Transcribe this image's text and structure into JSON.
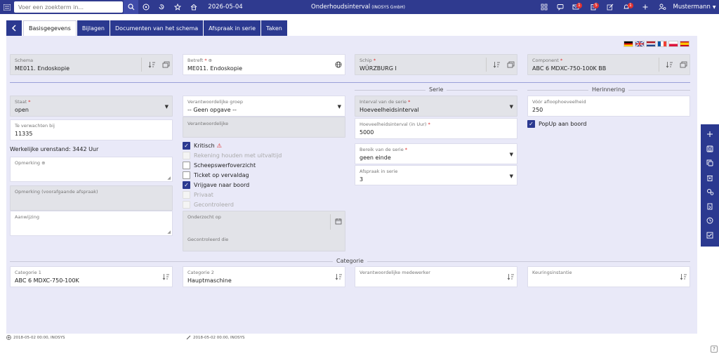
{
  "topbar": {
    "search_placeholder": "Voer een zoekterm in...",
    "date": "2026-05-04",
    "title": "Onderhoudsinterval",
    "company": "(INOSYS GmbH)",
    "mail_count": "1",
    "tasks_count": "5",
    "alerts_count": "1",
    "user": "Mustermann"
  },
  "tabs": [
    {
      "label": "Basisgegevens"
    },
    {
      "label": "Bijlagen"
    },
    {
      "label": "Documenten van het schema"
    },
    {
      "label": "Afspraak in serie"
    },
    {
      "label": "Taken"
    }
  ],
  "top_fields": {
    "schema": {
      "label": "Schema",
      "value": "ME011. Endoskopie"
    },
    "betreft": {
      "label": "Betreft",
      "value": "ME011. Endoskopie"
    },
    "schip": {
      "label": "Schip",
      "value": "WÜRZBURG I"
    },
    "component": {
      "label": "Component",
      "value": "ABC 6 MDXC-750-100K BB"
    }
  },
  "col1": {
    "staat": {
      "label": "Staat",
      "value": "open"
    },
    "te_verwachten": {
      "label": "Te verwachten bij",
      "value": "11335"
    },
    "werkelijke": "Werkelijke urenstand: 3442 Uur",
    "opmerking": {
      "label": "Opmerking"
    },
    "opmerking_voor": {
      "label": "Opmerking (voorafgaande afspraak)"
    },
    "aanwijzing": {
      "label": "Aanwijzing"
    }
  },
  "col2": {
    "groep": {
      "label": "Verantwoordelijke groep",
      "value": "-- Geen opgave --"
    },
    "verantwoordelijke": {
      "label": "Verantwoordelijke"
    },
    "checks": [
      {
        "label": "Kritisch",
        "checked": true
      },
      {
        "label": "Rekening houden met uitvaltijd",
        "checked": false
      },
      {
        "label": "Scheepswerfoverzicht",
        "checked": false
      },
      {
        "label": "Ticket op vervaldag",
        "checked": false
      },
      {
        "label": "Vrijgave naar boord",
        "checked": true
      },
      {
        "label": "Privaat",
        "checked": false
      },
      {
        "label": "Gecontroleerd",
        "checked": false
      }
    ],
    "onderzocht": {
      "label": "Onderzocht op"
    },
    "gecontroleerd_die": {
      "label": "Gecontroleerd die"
    }
  },
  "serie": {
    "title": "Serie",
    "interval": {
      "label": "Interval van de serie",
      "value": "Hoeveelheidsinterval"
    },
    "hoeveelheid": {
      "label": "Hoeveelheidsinterval (in Uur)",
      "value": "5000"
    },
    "bereik": {
      "label": "Bereik van de serie",
      "value": "geen einde"
    },
    "afspraak": {
      "label": "Afspraak in serie",
      "value": "3"
    }
  },
  "herinnering": {
    "title": "Herinnering",
    "voor": {
      "label": "Vóór afloophoeveelheid",
      "value": "250"
    },
    "popup": {
      "label": "PopUp aan boord",
      "checked": true
    }
  },
  "categorie": {
    "title": "Categorie",
    "cat1": {
      "label": "Categorie 1",
      "value": "ABC 6 MDXC-750-100K"
    },
    "cat2": {
      "label": "Categorie 2",
      "value": "Hauptmaschine"
    },
    "medewerker": {
      "label": "Verantwoordelijke medewerker"
    },
    "keuring": {
      "label": "Keuringsinstantie"
    }
  },
  "footer": {
    "created": "2018-05-02 00:00, INOSYS",
    "modified": "2018-05-02 00:00, INOSYS"
  },
  "colors": {
    "primary": "#2b3990",
    "topbar": "#2f3a8f",
    "panel": "#e9e9f8",
    "badge": "#e03131"
  }
}
